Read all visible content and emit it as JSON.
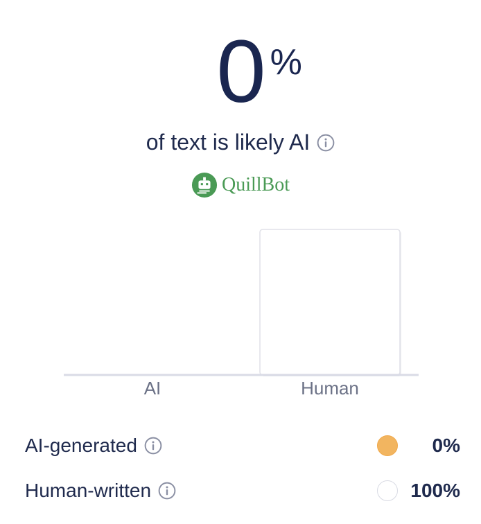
{
  "score": {
    "value": "0",
    "unit": "%"
  },
  "subtitle": {
    "text": "of text is likely AI",
    "info_icon": "info-icon"
  },
  "brand": {
    "name": "QuillBot",
    "logo_icon": "quillbot-logo-icon",
    "color": "#4a9a55"
  },
  "chart_data": {
    "type": "bar",
    "categories": [
      "AI",
      "Human"
    ],
    "values": [
      0,
      100
    ],
    "ylim": [
      0,
      100
    ],
    "colors": [
      "#f2b560",
      "#ffffff"
    ]
  },
  "legend": [
    {
      "label": "AI-generated",
      "value": "0%",
      "swatch_color": "#f2b560",
      "info_icon": "info-icon"
    },
    {
      "label": "Human-written",
      "value": "100%",
      "swatch_color": "#ffffff",
      "info_icon": "info-icon"
    }
  ],
  "colors": {
    "text_dark": "#1a2650",
    "axis": "#d9dbe6",
    "tick_text": "#6b7186"
  }
}
